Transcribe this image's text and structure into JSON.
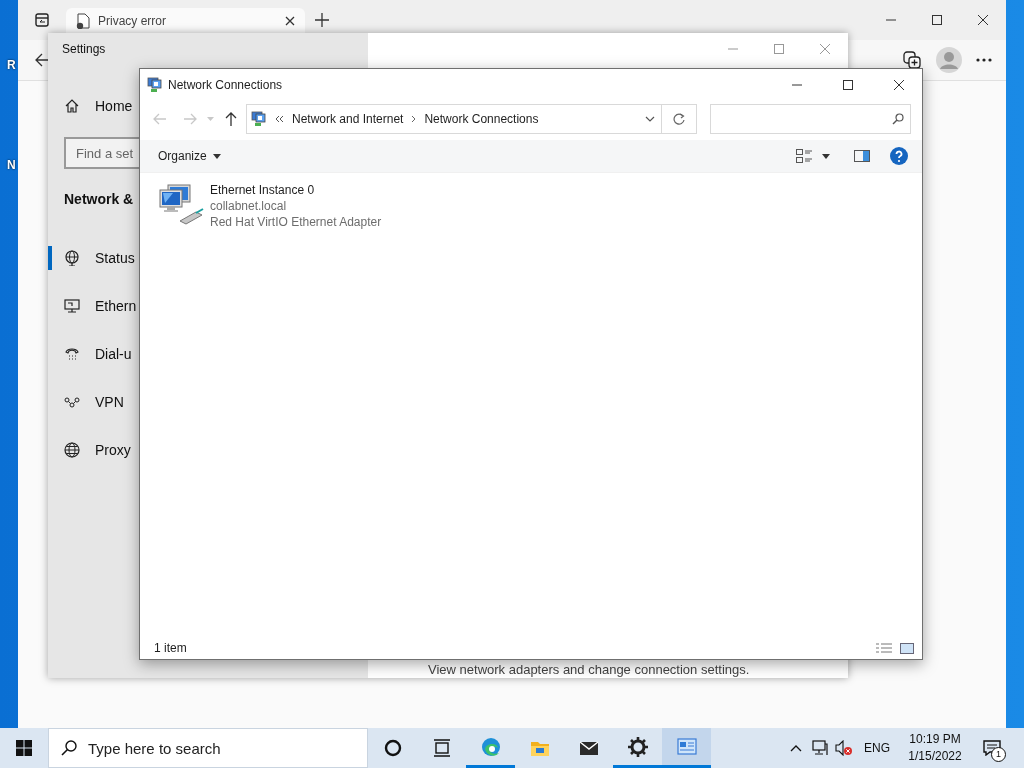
{
  "desktop": {
    "icon_labels": [
      "R",
      "N"
    ]
  },
  "browser": {
    "tab_title": "Privacy error"
  },
  "settings": {
    "title": "Settings",
    "home": "Home",
    "search": {
      "placeholder": "Find a set"
    },
    "section_heading": "Network &",
    "items": [
      {
        "kind": "status",
        "label": "Status",
        "selected": true
      },
      {
        "kind": "ethernet",
        "label": "Ethern",
        "selected": false
      },
      {
        "kind": "dialup",
        "label": "Dial-u",
        "selected": false
      },
      {
        "kind": "vpn",
        "label": "VPN",
        "selected": false
      },
      {
        "kind": "proxy",
        "label": "Proxy",
        "selected": false
      }
    ],
    "page_text": "View network adapters and change connection settings."
  },
  "explorer": {
    "title": "Network Connections",
    "breadcrumb": [
      "Network and Internet",
      "Network Connections"
    ],
    "organize": "Organize",
    "items": [
      {
        "name": "Ethernet Instance 0",
        "network": "collabnet.local",
        "device": "Red Hat VirtIO Ethernet Adapter"
      }
    ],
    "status": "1 item"
  },
  "taskbar": {
    "search_placeholder": "Type here to search",
    "apps": [
      {
        "kind": "cortana",
        "running": false,
        "selected": false
      },
      {
        "kind": "taskview",
        "running": false,
        "selected": false
      },
      {
        "kind": "edge",
        "running": true,
        "selected": false
      },
      {
        "kind": "explorer",
        "running": false,
        "selected": false
      },
      {
        "kind": "mail",
        "running": false,
        "selected": false
      },
      {
        "kind": "settings",
        "running": true,
        "selected": false
      },
      {
        "kind": "network",
        "running": true,
        "selected": true
      }
    ],
    "language": "ENG",
    "time": "10:19 PM",
    "date": "1/15/2022",
    "notification_count": "1"
  }
}
